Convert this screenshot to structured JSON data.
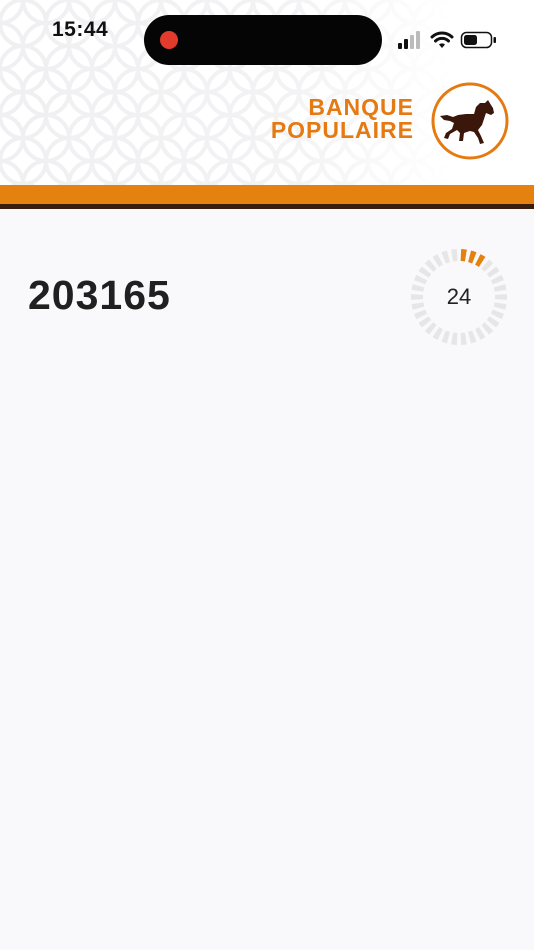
{
  "status_bar": {
    "time": "15:44",
    "icons": [
      "cellular-signal-icon",
      "wifi-icon",
      "battery-icon"
    ],
    "recording_color": "#e23b2e"
  },
  "brand": {
    "line1": "BANQUE",
    "line2": "POPULAIRE",
    "emblem": "horse-icon",
    "color": "#e57a12",
    "bar_color": "#e5810f",
    "bar_shadow_color": "#3a1d0a"
  },
  "otp": {
    "code": "203165",
    "seconds_remaining": "24",
    "countdown_segments_total": 30,
    "countdown_segments_active": 3,
    "active_color": "#e5810f",
    "inactive_color": "#e6e6e6"
  }
}
